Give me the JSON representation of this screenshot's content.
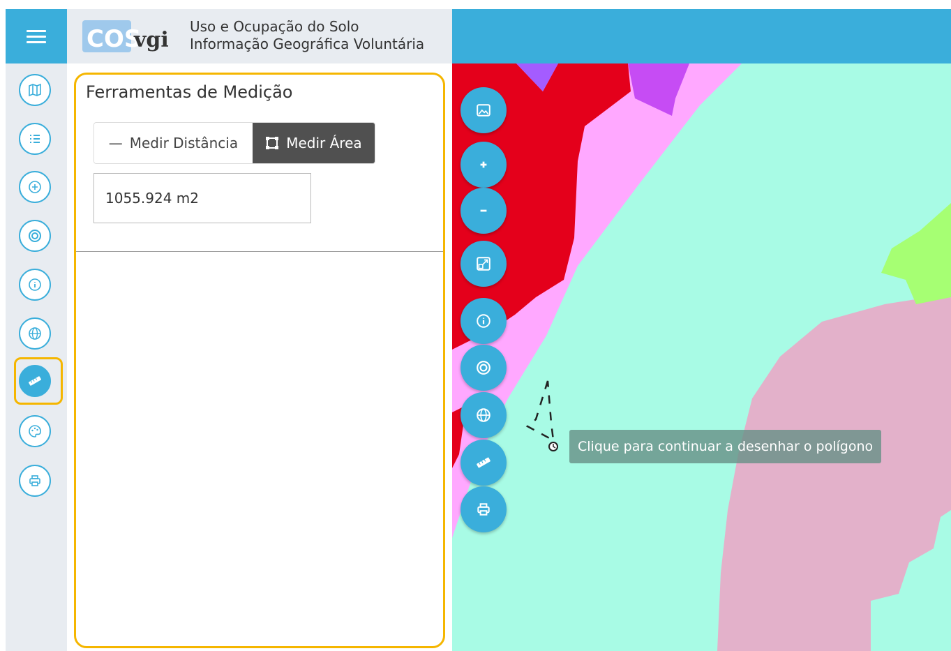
{
  "header": {
    "menu_icon": "hamburger-icon",
    "logo_text": "COS vgi",
    "title_line1": "Uso e Ocupação do Solo",
    "title_line2": "Informação Geográfica Voluntária",
    "accent_color": "#3aaedb"
  },
  "sidebar": {
    "items": [
      {
        "icon": "map-icon",
        "active": false
      },
      {
        "icon": "list-icon",
        "active": false
      },
      {
        "icon": "add-circle-icon",
        "active": false
      },
      {
        "icon": "target-icon",
        "active": false
      },
      {
        "icon": "info-icon",
        "active": false
      },
      {
        "icon": "globe-icon",
        "active": false
      },
      {
        "icon": "ruler-icon",
        "active": true
      },
      {
        "icon": "palette-icon",
        "active": false
      },
      {
        "icon": "print-icon",
        "active": false
      }
    ]
  },
  "panel": {
    "title": "Ferramentas de Medição",
    "measure_distance_label": "Medir Distância",
    "measure_area_label": "Medir Área",
    "selected_option": "Medir Área",
    "result_value": "1055.924 m2"
  },
  "map": {
    "tooltip": "Clique para continuar a desenhar o polígono",
    "controls": [
      {
        "icon": "image-icon"
      },
      {
        "icon": "zoom-in-icon"
      },
      {
        "icon": "zoom-out-icon"
      },
      {
        "icon": "zoom-extent-icon"
      },
      {
        "icon": "info-icon"
      },
      {
        "icon": "target-icon"
      },
      {
        "icon": "globe-icon"
      },
      {
        "icon": "ruler-icon"
      },
      {
        "icon": "print-icon"
      }
    ],
    "colors": {
      "water": "#a8fbe5",
      "urban": "#e4001b",
      "transport": "#ffa8ff",
      "pink": "#e3b1ca",
      "green": "#a6ff73",
      "purple": "#c64cf4"
    }
  }
}
